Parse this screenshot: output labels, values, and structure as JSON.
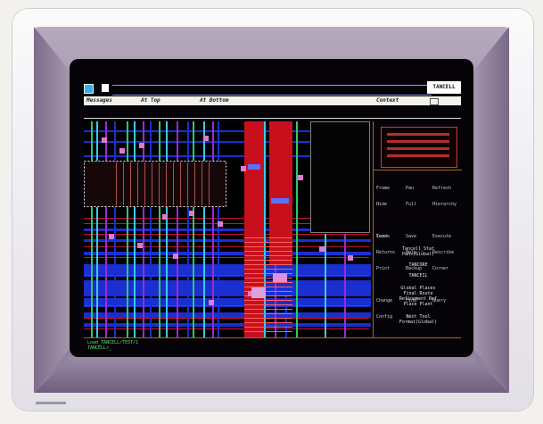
{
  "titlebar": {
    "label": "TANCELL"
  },
  "menu": {
    "items": [
      "Messages",
      "At Top",
      "At Bottom",
      "Context"
    ]
  },
  "colors": {
    "routing_blue": "#1a2fd0",
    "routing_green": "#2fc86a",
    "routing_cyan": "#3ec8e8",
    "block_red": "#c8101c",
    "pad_pink": "#e07ad0",
    "status_green": "#4fe06f"
  },
  "icons": [
    "window-icon",
    "page-icon",
    "close-box-icon"
  ],
  "panel": {
    "commands": [
      [
        "Frame",
        "Pan",
        "Refresh"
      ],
      [
        "Hide",
        "Full",
        "Hierarchy"
      ],
      [
        "Load",
        "Save",
        "Execute"
      ],
      [
        "Returns",
        "Help",
        "Describe"
      ],
      [
        "Print",
        "Backup",
        "Corner"
      ],
      [
        "Change",
        "Find",
        "Query"
      ],
      [
        "Config"
      ]
    ],
    "prompts": [
      "Terse",
      "Tancell_Stat",
      "Pans(Global)",
      "TANCORE",
      "TANCEIL",
      "Global Places",
      "Final Route",
      "Refinement Ref",
      "Place Plant",
      "Next Tool",
      "Format(Global)"
    ]
  },
  "status": {
    "line1": "Load_TANCELL/TEST/1",
    "line2": "TANCELL>_"
  }
}
